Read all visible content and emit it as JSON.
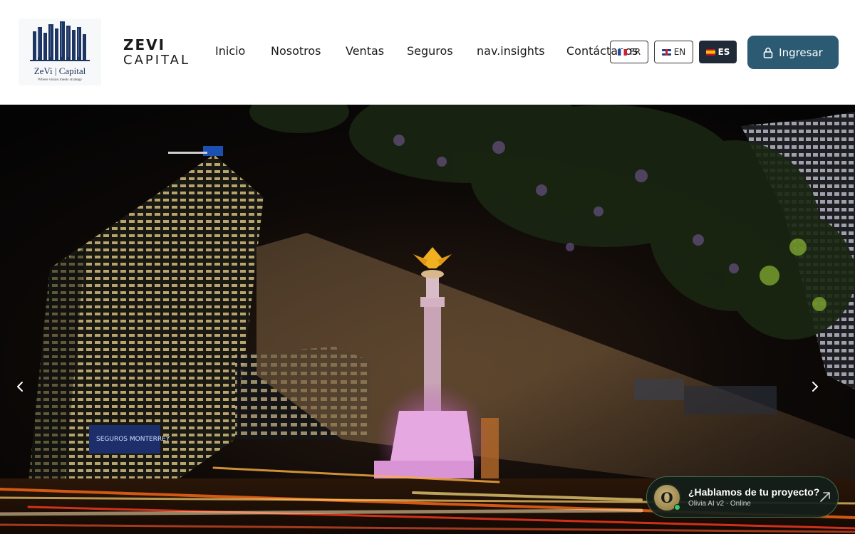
{
  "logo": {
    "name": "ZeVi | Capital",
    "tagline": "Where vision meets strategy"
  },
  "brand": {
    "line1": "ZEVI",
    "line2": "CAPITAL"
  },
  "nav": {
    "items": [
      {
        "label": "Inicio"
      },
      {
        "label": "Nosotros"
      },
      {
        "label": "Ventas"
      },
      {
        "label": "Seguros"
      },
      {
        "label": "nav.insights"
      },
      {
        "label": "Contáctanos"
      }
    ]
  },
  "languages": {
    "items": [
      {
        "code": "FR",
        "flag": "flag-fr-icon",
        "active": false
      },
      {
        "code": "EN",
        "flag": "flag-gb-icon",
        "active": false
      },
      {
        "code": "ES",
        "flag": "flag-es-icon",
        "active": true
      }
    ]
  },
  "login": {
    "label": "Ingresar",
    "icon": "lock-icon",
    "color": "#2b5a72"
  },
  "hero": {
    "description_icons": [
      "chevron-left-icon",
      "chevron-right-icon"
    ],
    "building_sign": "SEGUROS MONTERREY"
  },
  "chat": {
    "avatar_letter": "O",
    "title": "¿Hablamos de tu proyecto?",
    "subtitle": "Olivia AI v2 · Online",
    "status_color": "#3ac96a"
  }
}
